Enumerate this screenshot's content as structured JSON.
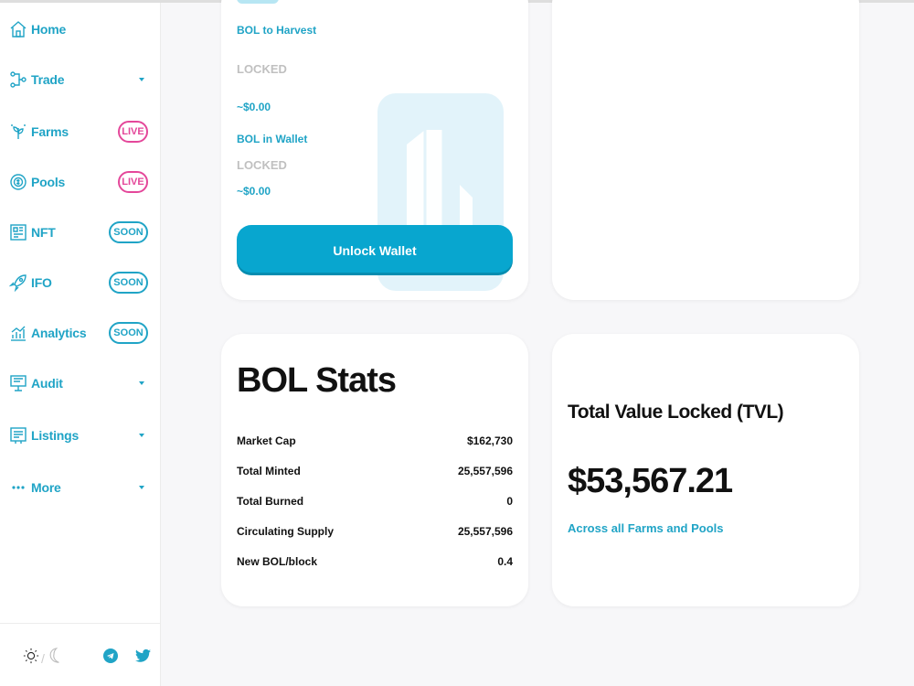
{
  "sidebar": {
    "items": [
      {
        "label": "Home",
        "icon": "home-icon"
      },
      {
        "label": "Trade",
        "icon": "trade-icon"
      },
      {
        "label": "Farms",
        "icon": "farms-icon",
        "badge": "LIVE"
      },
      {
        "label": "Pools",
        "icon": "pools-icon",
        "badge": "LIVE"
      },
      {
        "label": "NFT",
        "icon": "nft-icon",
        "badge": "SOON"
      },
      {
        "label": "IFO",
        "icon": "ifo-icon",
        "badge": "SOON"
      },
      {
        "label": "Analytics",
        "icon": "analytics-icon",
        "badge": "SOON"
      },
      {
        "label": "Audit",
        "icon": "audit-icon"
      },
      {
        "label": "Listings",
        "icon": "listings-icon"
      },
      {
        "label": "More",
        "icon": "more-icon"
      }
    ],
    "footer": {
      "theme_separator": "/"
    }
  },
  "harvest": {
    "bol_to_harvest_label": "BOL to Harvest",
    "harvest_status": "LOCKED",
    "harvest_usd": "~$0.00",
    "bol_in_wallet_label": "BOL in Wallet",
    "wallet_status": "LOCKED",
    "wallet_usd": "~$0.00",
    "unlock_button": "Unlock Wallet"
  },
  "stats": {
    "title": "BOL Stats",
    "rows": [
      {
        "label": "Market Cap",
        "value": "$162,730"
      },
      {
        "label": "Total Minted",
        "value": "25,557,596"
      },
      {
        "label": "Total Burned",
        "value": "0"
      },
      {
        "label": "Circulating Supply",
        "value": "25,557,596"
      },
      {
        "label": "New BOL/block",
        "value": "0.4"
      }
    ]
  },
  "tvl": {
    "title": "Total Value Locked (TVL)",
    "value": "$53,567.21",
    "subtitle": "Across all Farms and Pools"
  },
  "colors": {
    "accent": "#20a4c6",
    "button": "#08a6cf",
    "live": "#e4479a"
  }
}
